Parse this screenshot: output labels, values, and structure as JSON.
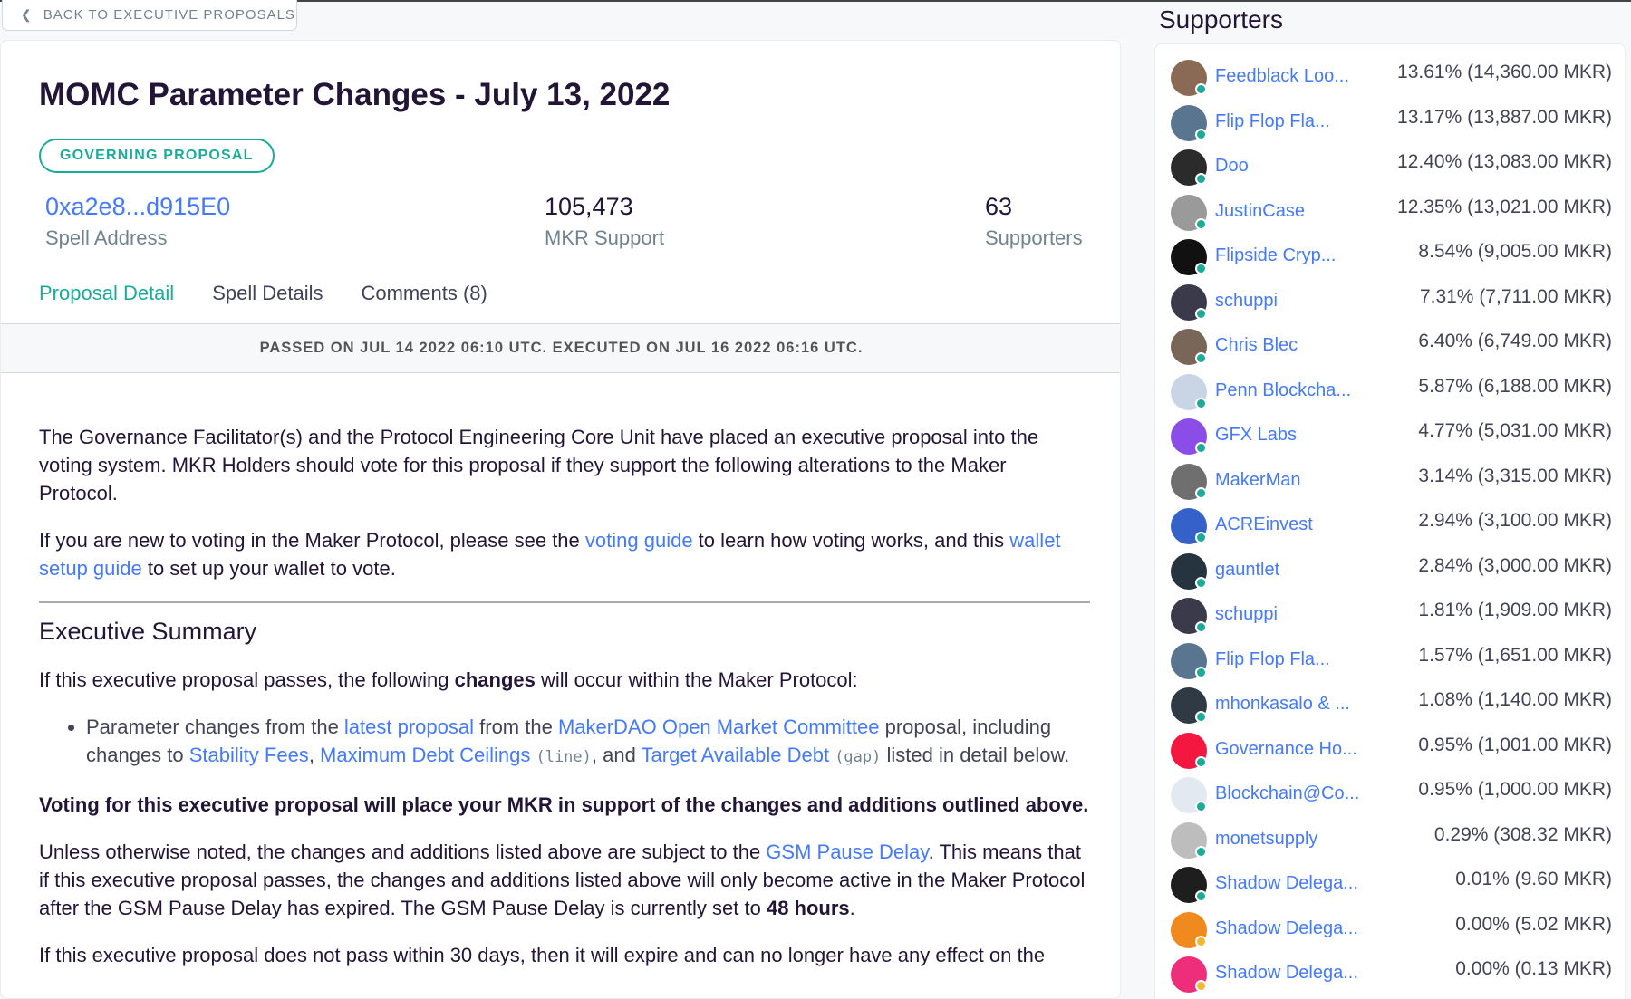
{
  "back": {
    "label": "BACK TO EXECUTIVE PROPOSALS"
  },
  "proposal": {
    "title": "MOMC Parameter Changes - July 13, 2022",
    "badge": "GOVERNING PROPOSAL",
    "spell_address": "0xa2e8...d915E0",
    "spell_address_label": "Spell Address",
    "mkr_support": "105,473",
    "mkr_support_label": "MKR Support",
    "supporters_count": "63",
    "supporters_label": "Supporters"
  },
  "tabs": [
    {
      "label": "Proposal Detail",
      "active": true
    },
    {
      "label": "Spell Details",
      "active": false
    },
    {
      "label": "Comments (8)",
      "active": false
    }
  ],
  "banner": "PASSED ON JUL 14 2022 06:10 UTC. EXECUTED ON JUL 16 2022 06:16 UTC.",
  "content": {
    "p1": "The Governance Facilitator(s) and the Protocol Engineering Core Unit have placed an executive proposal into the voting system. MKR Holders should vote for this proposal if they support the following alterations to the Maker Protocol.",
    "p2_a": "If you are new to voting in the Maker Protocol, please see the ",
    "p2_link1": "voting guide",
    "p2_b": " to learn how voting works, and this ",
    "p2_link2": "wallet setup guide",
    "p2_c": " to set up your wallet to vote.",
    "h2": "Executive Summary",
    "p3_a": "If this executive proposal passes, the following ",
    "p3_bold": "changes",
    "p3_b": " will occur within the Maker Protocol:",
    "li_a": "Parameter changes from the ",
    "li_link1": "latest proposal",
    "li_b": " from the ",
    "li_link2": "MakerDAO Open Market Committee",
    "li_c": " proposal, including changes to ",
    "li_link3": "Stability Fees",
    "li_d": ", ",
    "li_link4": "Maximum Debt Ceilings",
    "li_code1": "(line)",
    "li_e": ", and ",
    "li_link5": "Target Available Debt",
    "li_code2": "(gap)",
    "li_f": " listed in detail below.",
    "p4_bold": "Voting for this executive proposal will place your MKR in support of the changes and additions outlined above.",
    "p5_a": "Unless otherwise noted, the changes and additions listed above are subject to the ",
    "p5_link": "GSM Pause Delay",
    "p5_b": ". This means that if this executive proposal passes, the changes and additions listed above will only become active in the Maker Protocol after the GSM Pause Delay has expired. The GSM Pause Delay is currently set to ",
    "p5_bold": "48 hours",
    "p5_c": ".",
    "p6": "If this executive proposal does not pass within 30 days, then it will expire and can no longer have any effect on the"
  },
  "supporters": {
    "title": "Supporters",
    "list": [
      {
        "name": "Feedblack Loo...",
        "share": "13.61% (14,360.00 MKR)",
        "color": "#8a6a55",
        "badge": "ok"
      },
      {
        "name": "Flip Flop Fla...",
        "share": "13.17% (13,887.00 MKR)",
        "color": "#5a7590",
        "badge": "ok"
      },
      {
        "name": "Doo",
        "share": "12.40% (13,083.00 MKR)",
        "color": "#2b2b2b",
        "badge": "ok"
      },
      {
        "name": "JustinCase",
        "share": "12.35% (13,021.00 MKR)",
        "color": "#9a9a9a",
        "badge": "ok"
      },
      {
        "name": "Flipside Cryp...",
        "share": "8.54% (9,005.00 MKR)",
        "color": "#111111",
        "badge": "ok"
      },
      {
        "name": "schuppi",
        "share": "7.31% (7,711.00 MKR)",
        "color": "#3a3a4a",
        "badge": "ok"
      },
      {
        "name": "Chris Blec",
        "share": "6.40% (6,749.00 MKR)",
        "color": "#7a6658",
        "badge": "ok"
      },
      {
        "name": "Penn Blockcha...",
        "share": "5.87% (6,188.00 MKR)",
        "color": "#c9d4e4",
        "badge": "ok"
      },
      {
        "name": "GFX Labs",
        "share": "4.77% (5,031.00 MKR)",
        "color": "#8a4de8",
        "badge": "ok"
      },
      {
        "name": "MakerMan",
        "share": "3.14% (3,315.00 MKR)",
        "color": "#6f6f6f",
        "badge": "ok"
      },
      {
        "name": "ACREinvest",
        "share": "2.94% (3,100.00 MKR)",
        "color": "#3562c9",
        "badge": "ok"
      },
      {
        "name": "gauntlet",
        "share": "2.84% (3,000.00 MKR)",
        "color": "#263440",
        "badge": "ok"
      },
      {
        "name": "schuppi",
        "share": "1.81% (1,909.00 MKR)",
        "color": "#3a3a4a",
        "badge": "ok"
      },
      {
        "name": "Flip Flop Fla...",
        "share": "1.57% (1,651.00 MKR)",
        "color": "#5a7590",
        "badge": "ok"
      },
      {
        "name": "mhonkasalo & ...",
        "share": "1.08% (1,140.00 MKR)",
        "color": "#2f3a44",
        "badge": "ok"
      },
      {
        "name": "Governance Ho...",
        "share": "0.95% (1,001.00 MKR)",
        "color": "#f4173f",
        "badge": "ok"
      },
      {
        "name": "Blockchain@Co...",
        "share": "0.95% (1,000.00 MKR)",
        "color": "#e3e9f1",
        "badge": "ok"
      },
      {
        "name": "monetsupply",
        "share": "0.29% (308.32 MKR)",
        "color": "#bdbdbd",
        "badge": "ok"
      },
      {
        "name": "Shadow Delega...",
        "share": "0.01% (9.60 MKR)",
        "color": "#1e1e1e",
        "badge": "ok"
      },
      {
        "name": "Shadow Delega...",
        "share": "0.00% (5.02 MKR)",
        "color": "#f08a1e",
        "badge": "warn"
      },
      {
        "name": "Shadow Delega...",
        "share": "0.00% (0.13 MKR)",
        "color": "#ee2e7a",
        "badge": "warn"
      }
    ]
  },
  "colors": {
    "accent": "#1aab9b",
    "link": "#447afb",
    "text": "#231536",
    "muted": "#708390"
  }
}
